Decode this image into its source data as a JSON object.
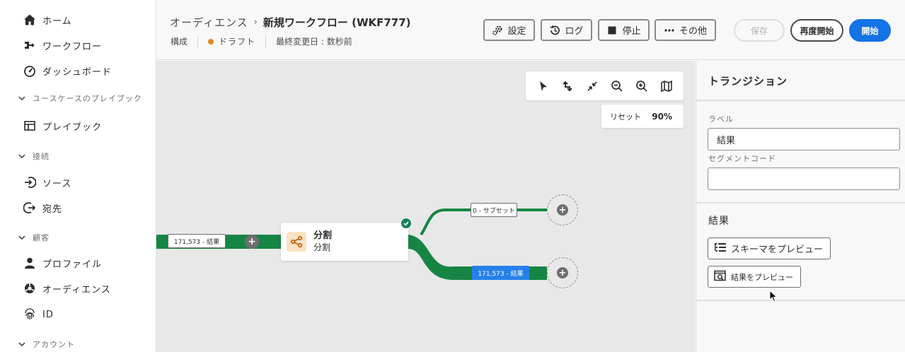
{
  "sidebar": {
    "items": [
      {
        "label": "ホーム",
        "icon": "home-icon"
      },
      {
        "label": "ワークフロー",
        "icon": "workflow-icon"
      },
      {
        "label": "ダッシュボード",
        "icon": "dashboard-icon"
      },
      {
        "label": "プレイブック",
        "icon": "playbook-icon"
      },
      {
        "label": "ソース",
        "icon": "source-icon"
      },
      {
        "label": "宛先",
        "icon": "destination-icon"
      },
      {
        "label": "プロファイル",
        "icon": "profile-icon"
      },
      {
        "label": "オーディエンス",
        "icon": "audience-icon"
      },
      {
        "label": "ID",
        "icon": "fingerprint-icon"
      }
    ],
    "sections": {
      "usecase": "ユースケースのプレイブック",
      "connections": "接続",
      "customer": "顧客",
      "account": "アカウント"
    }
  },
  "header": {
    "breadcrumb_parent": "オーディエンス",
    "title": "新規ワークフロー (WKF777)",
    "meta_config": "構成",
    "meta_status": "ドラフト",
    "meta_modified": "最終変更日 : 数秒前",
    "status_color": "#e68619",
    "buttons": {
      "settings": "設定",
      "log": "ログ",
      "stop": "停止",
      "more": "その他",
      "save": "保存",
      "restart": "再度開始",
      "start": "開始"
    }
  },
  "canvas": {
    "reset_label": "リセット",
    "zoom": "90%",
    "node": {
      "title": "分割",
      "subtitle": "分割"
    },
    "links": {
      "incoming": "171,573 - 結果",
      "subset": "0 - サブセット",
      "result": "171,573 - 結果"
    },
    "flow_color": "#168543",
    "selected_color": "#2680eb"
  },
  "panel": {
    "title": "トランジション",
    "label_field_label": "ラベル",
    "label_value": "結果",
    "segment_label": "セグメントコード",
    "segment_value": "",
    "section_title": "結果",
    "preview_schema": "スキーマをプレビュー",
    "preview_results": "結果をプレビュー"
  }
}
